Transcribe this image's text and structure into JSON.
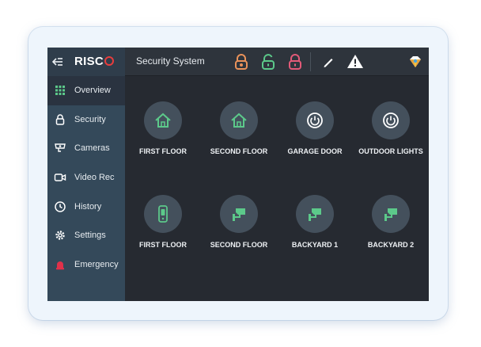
{
  "header": {
    "brand": "RISC",
    "title": "Security System",
    "icons": [
      {
        "name": "lock-partial-icon",
        "color": "#e9925a"
      },
      {
        "name": "lock-open-icon",
        "color": "#5cc98a"
      },
      {
        "name": "lock-closed-icon",
        "color": "#e25a78"
      },
      {
        "name": "pencil-icon",
        "color": "#ffffff"
      },
      {
        "name": "warning-icon",
        "color": "#ffffff"
      },
      {
        "name": "status-gem-icon",
        "color": "#f4c542"
      }
    ]
  },
  "sidebar": {
    "items": [
      {
        "label": "Overview",
        "icon": "grid-icon",
        "active": true
      },
      {
        "label": "Security",
        "icon": "lock-icon"
      },
      {
        "label": "Cameras",
        "icon": "camera-icon"
      },
      {
        "label": "Video Rec",
        "icon": "video-icon"
      },
      {
        "label": "History",
        "icon": "history-icon"
      },
      {
        "label": "Settings",
        "icon": "gear-icon"
      },
      {
        "label": "Emergency",
        "icon": "siren-icon"
      }
    ]
  },
  "tiles": [
    {
      "label": "FIRST FLOOR",
      "icon": "house-icon"
    },
    {
      "label": "SECOND FLOOR",
      "icon": "house-icon"
    },
    {
      "label": "GARAGE DOOR",
      "icon": "power-icon"
    },
    {
      "label": "OUTDOOR LIGHTS",
      "icon": "power-icon"
    },
    {
      "label": "FIRST FLOOR",
      "icon": "keypad-icon"
    },
    {
      "label": "SECOND FLOOR",
      "icon": "cctv-camera-icon"
    },
    {
      "label": "BACKYARD 1",
      "icon": "cctv-camera-icon"
    },
    {
      "label": "BACKYARD 2",
      "icon": "cctv-camera-icon"
    }
  ],
  "colors": {
    "accent_green": "#5cc98a",
    "siren_red": "#e0314a"
  }
}
